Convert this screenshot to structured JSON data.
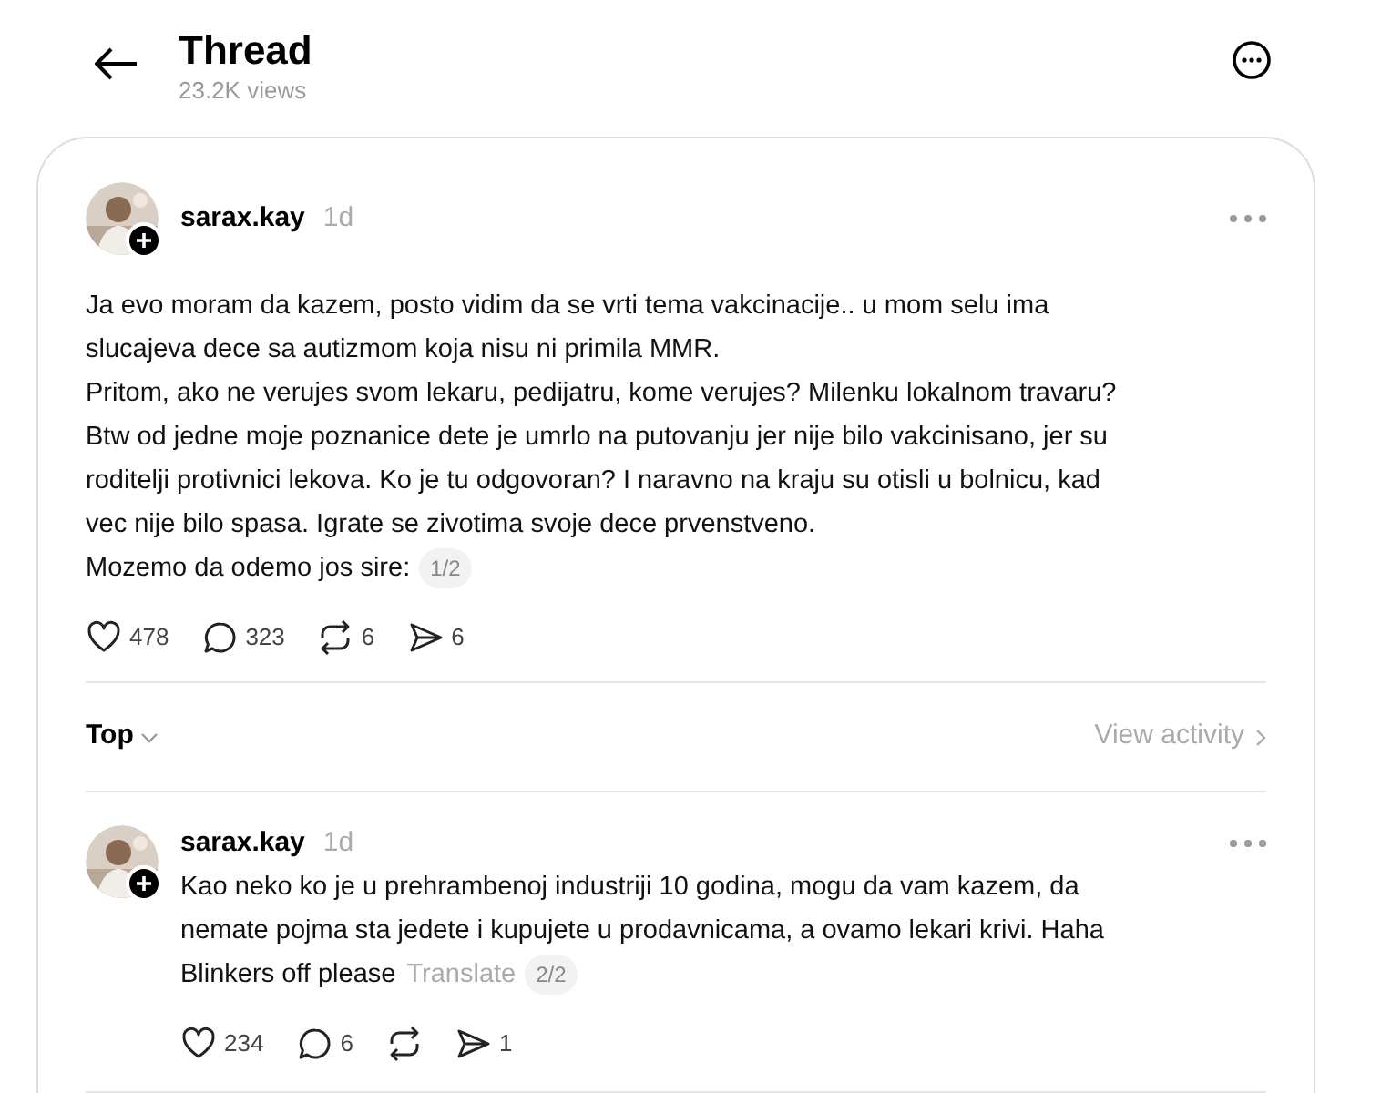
{
  "header": {
    "title": "Thread",
    "views": "23.2K views"
  },
  "posts": [
    {
      "username": "sarax.kay",
      "time": "1d",
      "lines": [
        "Ja evo moram da kazem, posto vidim da se vrti tema vakcinacije.. u mom selu ima",
        "slucajeva dece sa autizmom koja nisu ni primila MMR.",
        "Pritom, ako ne verujes svom lekaru, pedijatru, kome verujes? Milenku lokalnom travaru?",
        "Btw od jedne moje poznanice dete je umrlo na putovanju jer nije bilo vakcinisano, jer su",
        "roditelji protivnici lekova. Ko je tu odgovoran? I naravno na kraju su otisli u bolnicu, kad",
        "vec nije bilo spasa. Igrate se zivotima svoje dece prvenstveno.",
        "Mozemo da odemo jos sire:"
      ],
      "page": "1/2",
      "likes": "478",
      "replies": "323",
      "reposts": "6",
      "shares": "6"
    },
    {
      "username": "sarax.kay",
      "time": "1d",
      "lines": [
        "Kao neko ko je u prehrambenoj industriji 10 godina, mogu da vam kazem, da",
        "nemate pojma sta jedete i kupujete u prodavnicama, a ovamo lekari krivi. Haha",
        "Blinkers off please"
      ],
      "translate": "Translate",
      "page": "2/2",
      "likes": "234",
      "replies": "6",
      "shares": "1"
    }
  ],
  "sort": {
    "label": "Top",
    "activity": "View activity"
  }
}
